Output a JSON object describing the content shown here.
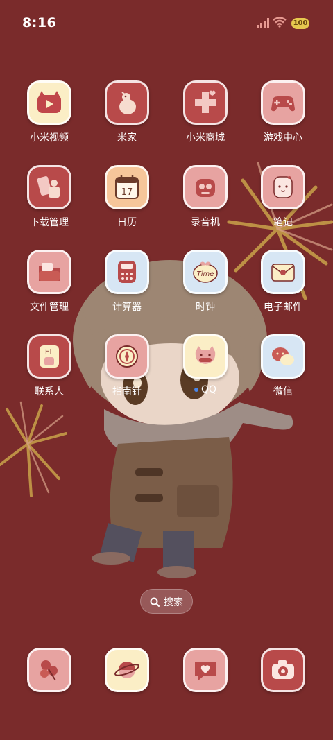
{
  "status_bar": {
    "time": "8:16",
    "battery": "100"
  },
  "apps": [
    {
      "label": "小米视频"
    },
    {
      "label": "米家"
    },
    {
      "label": "小米商城"
    },
    {
      "label": "游戏中心"
    },
    {
      "label": "下载管理"
    },
    {
      "label": "日历",
      "calendar_day": "17"
    },
    {
      "label": "录音机"
    },
    {
      "label": "笔记"
    },
    {
      "label": "文件管理"
    },
    {
      "label": "计算器"
    },
    {
      "label": "时钟",
      "clock_text": "Time"
    },
    {
      "label": "电子邮件"
    },
    {
      "label": "联系人",
      "badge_text": "Hi"
    },
    {
      "label": "指南针"
    },
    {
      "label": "QQ"
    },
    {
      "label": "微信"
    }
  ],
  "search": {
    "label": "搜索"
  },
  "dock": [
    {
      "icon": "flower-icon"
    },
    {
      "icon": "planet-icon"
    },
    {
      "icon": "heart-chat-icon"
    },
    {
      "icon": "camera-icon"
    }
  ],
  "colors": {
    "background": "#7a2b2b",
    "icon_red": "#b84a4a",
    "icon_pink": "#e7a3a1",
    "icon_cream": "#fbeec6",
    "icon_blue": "#d7e6f4",
    "accent_gold": "#c9a24a"
  }
}
